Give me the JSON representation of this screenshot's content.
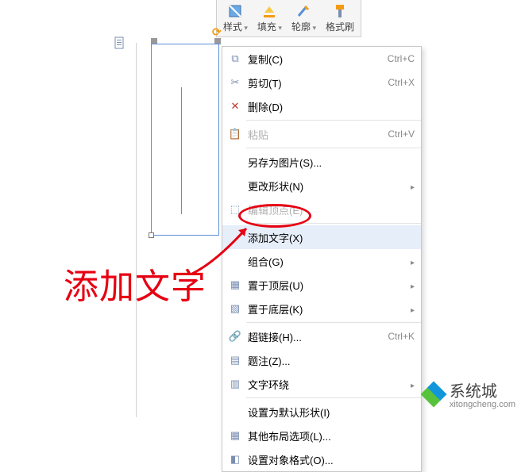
{
  "toolbar": {
    "style": "样式",
    "fill": "填充",
    "outline": "轮廓",
    "format_painter": "格式刷"
  },
  "menu": {
    "copy": {
      "label": "复制(C)",
      "shortcut": "Ctrl+C"
    },
    "cut": {
      "label": "剪切(T)",
      "shortcut": "Ctrl+X"
    },
    "delete": {
      "label": "删除(D)",
      "shortcut": ""
    },
    "paste": {
      "label": "粘贴",
      "shortcut": "Ctrl+V"
    },
    "save_as_pic": {
      "label": "另存为图片(S)..."
    },
    "change_shape": {
      "label": "更改形状(N)"
    },
    "edit_points": {
      "label": "编辑顶点(E)"
    },
    "add_text": {
      "label": "添加文字(X)"
    },
    "group": {
      "label": "组合(G)"
    },
    "bring_front": {
      "label": "置于顶层(U)"
    },
    "send_back": {
      "label": "置于底层(K)"
    },
    "hyperlink": {
      "label": "超链接(H)...",
      "shortcut": "Ctrl+K"
    },
    "caption": {
      "label": "题注(Z)..."
    },
    "text_wrap": {
      "label": "文字环绕"
    },
    "set_default": {
      "label": "设置为默认形状(I)"
    },
    "more_layout": {
      "label": "其他布局选项(L)..."
    },
    "format_obj": {
      "label": "设置对象格式(O)..."
    }
  },
  "annotation": {
    "label": "添加文字"
  },
  "watermark": {
    "cn": "系统城",
    "en": "xitongcheng.com"
  }
}
